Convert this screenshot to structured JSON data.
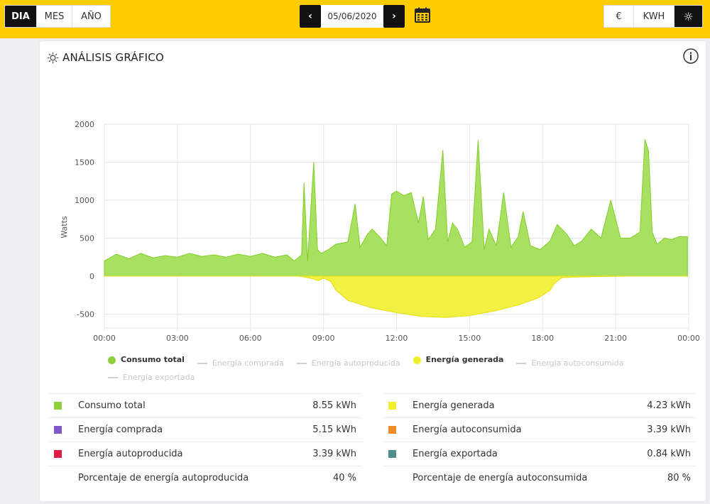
{
  "topbar": {
    "periods": [
      {
        "label": "DIA",
        "active": true
      },
      {
        "label": "MES",
        "active": false
      },
      {
        "label": "AÑO",
        "active": false
      }
    ],
    "date_value": "05/06/2020",
    "prev_symbol": "‹",
    "next_symbol": "›",
    "units": [
      {
        "label": "€",
        "active": false
      },
      {
        "label": "KWH",
        "active": false
      },
      {
        "label": "☼",
        "active": true
      }
    ]
  },
  "panel": {
    "title": "ANÁLISIS GRÁFICO"
  },
  "chart_data": {
    "type": "area",
    "ylabel": "Watts",
    "ylim": [
      -600,
      2000
    ],
    "yticks": [
      "2000",
      "1500",
      "1000",
      "500",
      "0",
      "-500"
    ],
    "ytick_values": [
      2000,
      1500,
      1000,
      500,
      0,
      -500
    ],
    "xlim": [
      0,
      24
    ],
    "xticks": [
      "00:00",
      "03:00",
      "06:00",
      "09:00",
      "12:00",
      "15:00",
      "18:00",
      "21:00",
      "00:00"
    ],
    "xtick_values": [
      0,
      3,
      6,
      9,
      12,
      15,
      18,
      21,
      24
    ],
    "grid": true,
    "series": [
      {
        "name": "Consumo total",
        "color": "#8fd13a",
        "x": [
          0,
          0.5,
          1,
          1.5,
          2,
          2.5,
          3,
          3.5,
          4,
          4.5,
          5,
          5.5,
          6,
          6.5,
          7,
          7.5,
          7.8,
          8.1,
          8.2,
          8.35,
          8.5,
          8.6,
          8.75,
          8.9,
          9.2,
          9.5,
          10,
          10.3,
          10.5,
          10.8,
          11,
          11.3,
          11.6,
          11.8,
          12,
          12.3,
          12.6,
          12.9,
          13.1,
          13.3,
          13.6,
          13.9,
          14.1,
          14.3,
          14.5,
          14.8,
          15.1,
          15.35,
          15.6,
          15.8,
          16.1,
          16.4,
          16.7,
          17,
          17.2,
          17.5,
          17.9,
          18.3,
          18.6,
          19,
          19.3,
          19.6,
          20,
          20.4,
          20.8,
          21.2,
          21.6,
          22,
          22.2,
          22.35,
          22.5,
          22.7,
          23,
          23.3,
          23.6,
          23.95
        ],
        "values": [
          200,
          290,
          230,
          300,
          240,
          270,
          250,
          300,
          260,
          280,
          250,
          290,
          260,
          300,
          250,
          280,
          200,
          280,
          1230,
          200,
          1000,
          1500,
          350,
          300,
          350,
          420,
          450,
          950,
          380,
          550,
          620,
          520,
          400,
          1080,
          1120,
          1060,
          1100,
          700,
          1050,
          480,
          620,
          1660,
          450,
          700,
          620,
          380,
          450,
          1790,
          350,
          620,
          400,
          1100,
          380,
          520,
          850,
          400,
          350,
          460,
          680,
          550,
          400,
          460,
          620,
          500,
          1000,
          500,
          500,
          580,
          1800,
          1650,
          580,
          420,
          500,
          480,
          520,
          520
        ]
      },
      {
        "name": "Energía generada",
        "color": "#f2ef2f",
        "x": [
          0,
          8,
          8.5,
          8.8,
          9,
          9.3,
          9.5,
          10,
          11,
          12,
          13,
          14,
          15,
          16,
          17,
          17.8,
          18.3,
          18.5,
          18.8,
          19.5,
          20.5,
          21.5,
          24
        ],
        "values": [
          0,
          0,
          -30,
          -60,
          -25,
          -70,
          -180,
          -320,
          -420,
          -480,
          -530,
          -545,
          -520,
          -460,
          -380,
          -290,
          -190,
          -90,
          -20,
          -10,
          -5,
          0,
          0
        ]
      }
    ],
    "legend": [
      {
        "name": "Consumo total",
        "shape": "dot",
        "active": true,
        "color": "#8fd13a"
      },
      {
        "name": "Energía comprada",
        "shape": "line",
        "active": false
      },
      {
        "name": "Energía autoproducida",
        "shape": "line",
        "active": false
      },
      {
        "name": "Energía generada",
        "shape": "dot",
        "active": true,
        "color": "#f2ef2f"
      },
      {
        "name": "Energía autoconsumida",
        "shape": "line",
        "active": false
      },
      {
        "name": "Energía exportada",
        "shape": "line",
        "active": false
      }
    ]
  },
  "stats_left": [
    {
      "label": "Consumo total",
      "value": "8.55 kWh",
      "color": "#8fd13a"
    },
    {
      "label": "Energía comprada",
      "value": "5.15 kWh",
      "color": "#7f57c8"
    },
    {
      "label": "Energía autoproducida",
      "value": "3.39 kWh",
      "color": "#e01b45"
    },
    {
      "label": "Porcentaje de energía autoproducida",
      "value": "40 %",
      "color": ""
    }
  ],
  "stats_right": [
    {
      "label": "Energía generada",
      "value": "4.23 kWh",
      "color": "#f2ef2f"
    },
    {
      "label": "Energía autoconsumida",
      "value": "3.39 kWh",
      "color": "#f08a24"
    },
    {
      "label": "Energía exportada",
      "value": "0.84 kWh",
      "color": "#4d8f8a"
    },
    {
      "label": "Porcentaje de energía autoconsumida",
      "value": "80 %",
      "color": ""
    }
  ]
}
